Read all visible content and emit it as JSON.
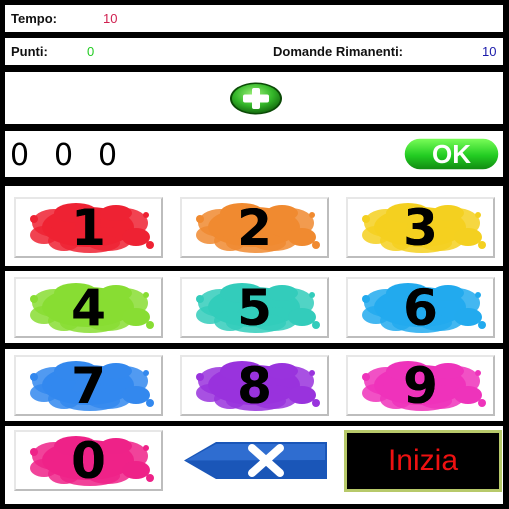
{
  "status": {
    "tempo_label": "Tempo:",
    "tempo_value": "10",
    "punti_label": "Punti:",
    "punti_value": "0",
    "domande_label": "Domande Rimanenti:",
    "domande_value": "10"
  },
  "answer": {
    "digits": [
      "0",
      "0",
      "0"
    ],
    "ok_label": "OK"
  },
  "keypad": {
    "keys": [
      "1",
      "2",
      "3",
      "4",
      "5",
      "6",
      "7",
      "8",
      "9",
      "0"
    ],
    "start_label": "Inizia"
  },
  "colors": {
    "tempo_value": "#d02050",
    "punti_value": "#22cc22",
    "domande_value": "#1a1aaa",
    "ok_green": "#22cc22",
    "inizia_text": "#ee1111",
    "key1": "#ee2233",
    "key2": "#f08a30",
    "key3": "#f4d020",
    "key4": "#88dd33",
    "key5": "#33ccbb",
    "key6": "#22aaee",
    "key7": "#3388ee",
    "key8": "#9933dd",
    "key9": "#ee33bb",
    "key0": "#ee2288"
  },
  "icons": {
    "add": "plus-circle-icon",
    "backspace": "backspace-x-icon"
  }
}
